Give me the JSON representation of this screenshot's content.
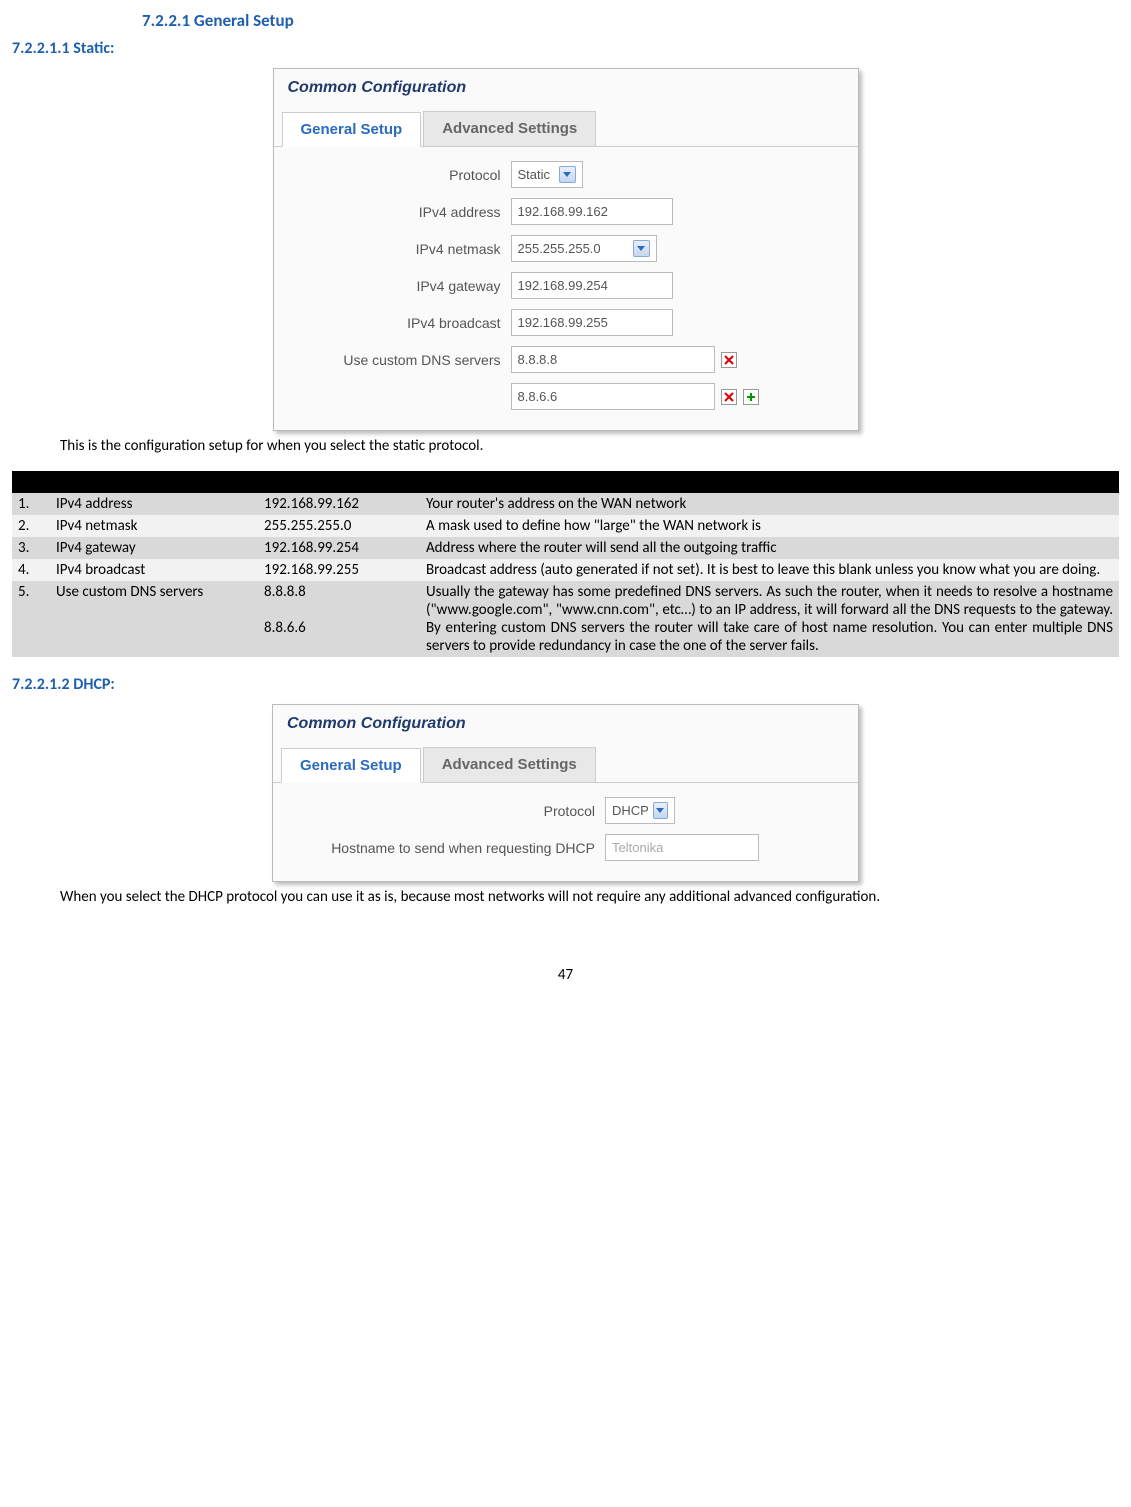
{
  "headings": {
    "h3": "7.2.2.1    General Setup",
    "h4_static": "7.2.2.1.1   Static:",
    "h4_dhcp": "7.2.2.1.2   DHCP:"
  },
  "panel_static": {
    "title": "Common Configuration",
    "tab_active": "General Setup",
    "tab_inactive": "Advanced Settings",
    "rows": {
      "protocol_label": "Protocol",
      "protocol_value": "Static",
      "ipv4addr_label": "IPv4 address",
      "ipv4addr_value": "192.168.99.162",
      "netmask_label": "IPv4 netmask",
      "netmask_value": "255.255.255.0",
      "gateway_label": "IPv4 gateway",
      "gateway_value": "192.168.99.254",
      "broadcast_label": "IPv4 broadcast",
      "broadcast_value": "192.168.99.255",
      "dns_label": "Use custom DNS servers",
      "dns1_value": "8.8.8.8",
      "dns2_value": "8.8.6.6"
    }
  },
  "panel_dhcp": {
    "title": "Common Configuration",
    "tab_active": "General Setup",
    "tab_inactive": "Advanced Settings",
    "rows": {
      "protocol_label": "Protocol",
      "protocol_value": "DHCP",
      "hostname_label": "Hostname to send when requesting DHCP",
      "hostname_placeholder": "Teltonika"
    }
  },
  "paragraphs": {
    "static_desc": "This is the configuration setup for when you select the static protocol.",
    "dhcp_desc": "When you select the DHCP protocol you can use it as is, because most networks will not require any additional advanced configuration."
  },
  "table": [
    {
      "num": "1.",
      "name": "IPv4 address",
      "val": "192.168.99.162",
      "desc": "Your router's address on the WAN network"
    },
    {
      "num": "2.",
      "name": "IPv4 netmask",
      "val": "255.255.255.0",
      "desc": "A mask used to define how \"large\" the WAN network is"
    },
    {
      "num": "3.",
      "name": "IPv4 gateway",
      "val": "192.168.99.254",
      "desc": "Address where the router will send all the outgoing traffic"
    },
    {
      "num": "4.",
      "name": "IPv4 broadcast",
      "val": "192.168.99.255",
      "desc": "Broadcast address (auto generated if not set). It is best to leave this blank unless you know what you are doing."
    },
    {
      "num": "5.",
      "name": "Use custom DNS servers",
      "val": "8.8.8.8\n\n8.8.6.6",
      "desc": "Usually the gateway has some predefined DNS servers. As such the router, when it needs to resolve a hostname (\"www.google.com\", \"www.cnn.com\", etc…) to an IP address, it will forward all the DNS requests to the gateway. By entering custom DNS servers the router will take care of host name resolution. You can enter multiple DNS servers to provide redundancy in case the one of the server fails."
    }
  ],
  "page_number": "47"
}
